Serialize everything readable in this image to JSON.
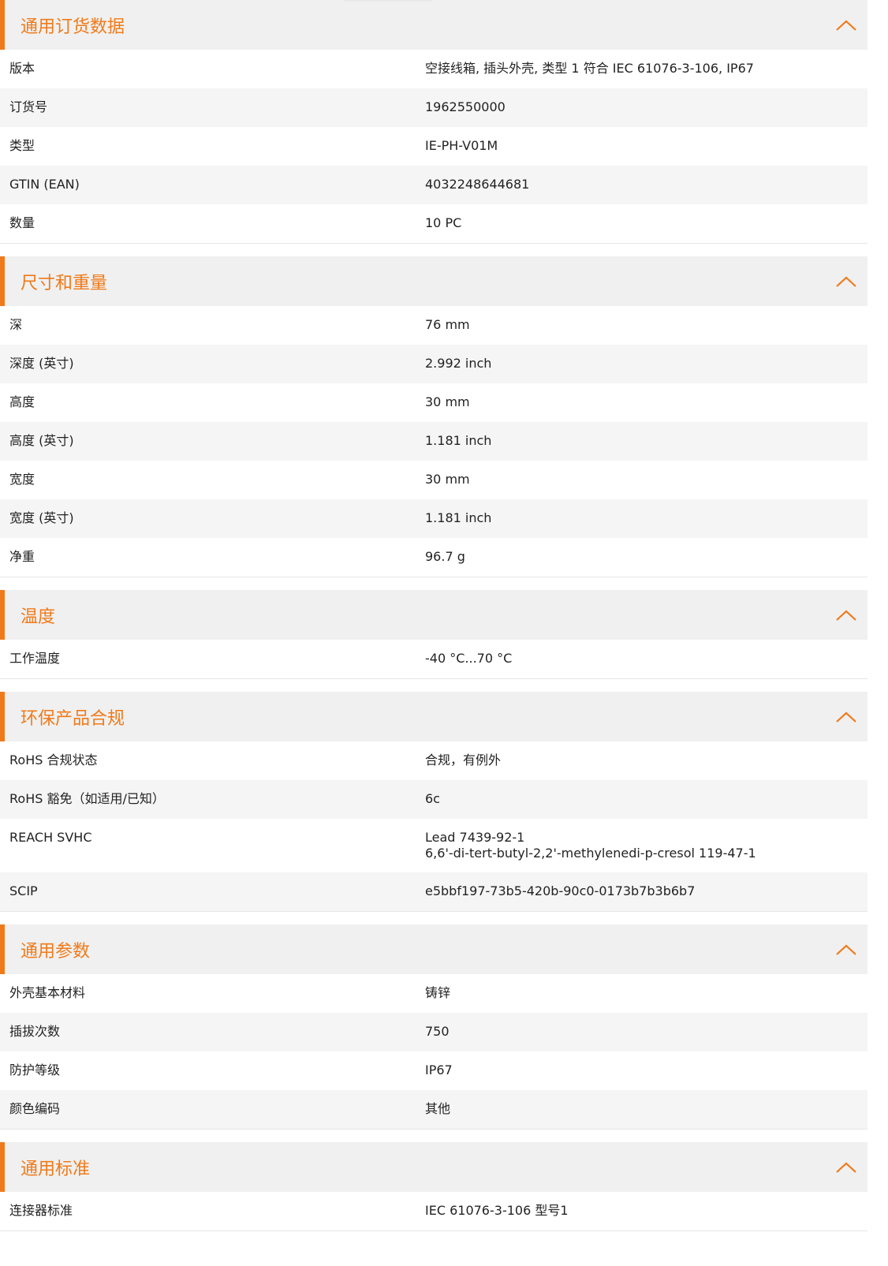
{
  "theme": {
    "accent": "#f07a1a",
    "header_bg": "#f0f0f0",
    "row_alt_bg": "#f5f5f5"
  },
  "sections": [
    {
      "title": "通用订货数据",
      "icon": "chevron-up-icon",
      "rows": [
        {
          "label": "版本",
          "value": [
            "空接线箱, 插头外壳, 类型 1 符合 IEC 61076-3-106, IP67"
          ]
        },
        {
          "label": "订货号",
          "value": [
            "1962550000"
          ]
        },
        {
          "label": "类型",
          "value": [
            "IE-PH-V01M"
          ]
        },
        {
          "label": "GTIN (EAN)",
          "value": [
            "4032248644681"
          ]
        },
        {
          "label": "数量",
          "value": [
            "10  PC"
          ]
        }
      ]
    },
    {
      "title": "尺寸和重量",
      "icon": "chevron-up-icon",
      "rows": [
        {
          "label": "深",
          "value": [
            "76  mm"
          ]
        },
        {
          "label": "深度 (英寸)",
          "value": [
            "2.992  inch"
          ]
        },
        {
          "label": "高度",
          "value": [
            "30  mm"
          ]
        },
        {
          "label": "高度 (英寸)",
          "value": [
            "1.181  inch"
          ]
        },
        {
          "label": "宽度",
          "value": [
            "30  mm"
          ]
        },
        {
          "label": "宽度 (英寸)",
          "value": [
            "1.181  inch"
          ]
        },
        {
          "label": "净重",
          "value": [
            "96.7  g"
          ]
        }
      ]
    },
    {
      "title": "温度",
      "icon": "chevron-up-icon",
      "rows": [
        {
          "label": "工作温度",
          "value": [
            "-40 °C...70 °C"
          ]
        }
      ]
    },
    {
      "title": "环保产品合规",
      "icon": "chevron-up-icon",
      "rows": [
        {
          "label": "RoHS 合规状态",
          "value": [
            "合规，有例外"
          ]
        },
        {
          "label": "RoHS 豁免（如适用/已知）",
          "value": [
            "6c"
          ]
        },
        {
          "label": "REACH SVHC",
          "value": [
            "Lead 7439-92-1",
            "6,6'-di-tert-butyl-2,2'-methylenedi-p-cresol 119-47-1"
          ]
        },
        {
          "label": "SCIP",
          "value": [
            "e5bbf197-73b5-420b-90c0-0173b7b3b6b7"
          ]
        }
      ]
    },
    {
      "title": "通用参数",
      "icon": "chevron-up-icon",
      "rows": [
        {
          "label": "外壳基本材料",
          "value": [
            "铸锌"
          ]
        },
        {
          "label": "插拔次数",
          "value": [
            "750"
          ]
        },
        {
          "label": "防护等级",
          "value": [
            "IP67"
          ]
        },
        {
          "label": "颜色编码",
          "value": [
            "其他"
          ]
        }
      ]
    },
    {
      "title": "通用标准",
      "icon": "chevron-up-icon",
      "rows": [
        {
          "label": "连接器标准",
          "value": [
            "IEC 61076-3-106 型号1"
          ]
        }
      ]
    }
  ]
}
